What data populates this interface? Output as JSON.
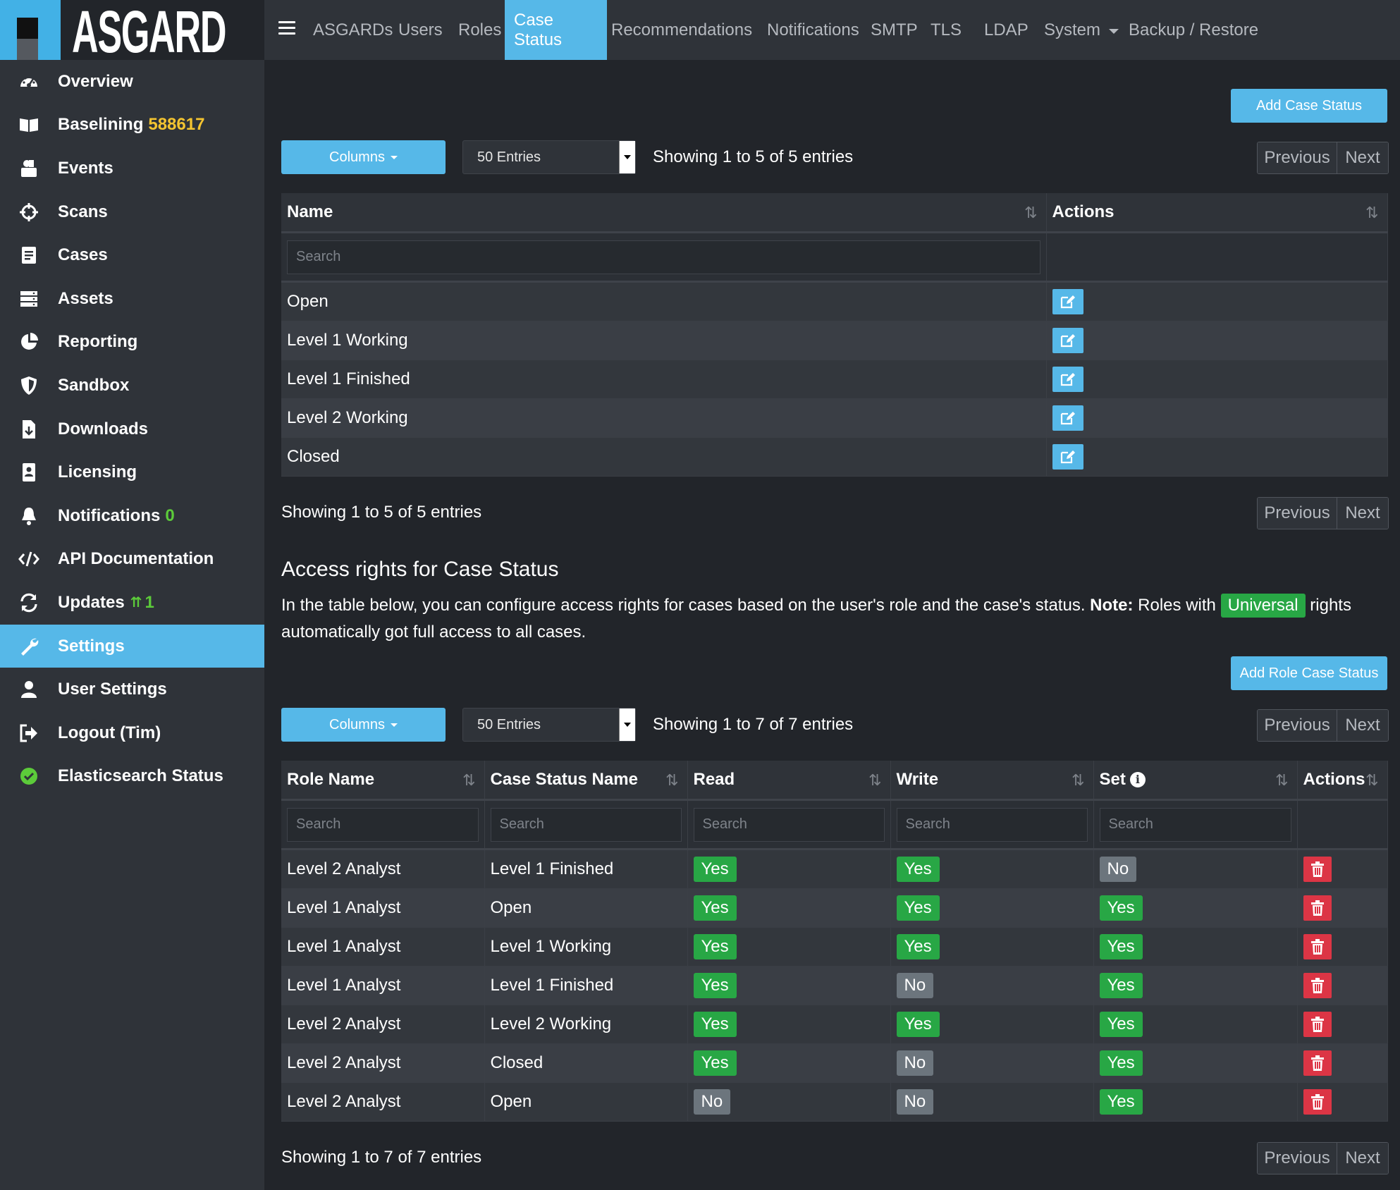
{
  "brand": {
    "name": "ASGARD"
  },
  "sidebar": {
    "items": [
      {
        "label": "Overview",
        "icon": "dashboard-icon"
      },
      {
        "label": "Baselining",
        "icon": "book-icon",
        "badge": "588617",
        "badge_color": "#f4c430"
      },
      {
        "label": "Events",
        "icon": "events-icon"
      },
      {
        "label": "Scans",
        "icon": "crosshair-icon"
      },
      {
        "label": "Cases",
        "icon": "cases-icon"
      },
      {
        "label": "Assets",
        "icon": "assets-icon"
      },
      {
        "label": "Reporting",
        "icon": "pie-chart-icon"
      },
      {
        "label": "Sandbox",
        "icon": "shield-icon"
      },
      {
        "label": "Downloads",
        "icon": "download-file-icon"
      },
      {
        "label": "Licensing",
        "icon": "license-icon"
      },
      {
        "label": "Notifications",
        "icon": "bell-icon",
        "badge": "0",
        "badge_color": "#5ccb3a"
      },
      {
        "label": "API Documentation",
        "icon": "code-icon"
      },
      {
        "label": "Updates",
        "icon": "sync-icon",
        "badge": "1",
        "badge_color": "#5ccb3a"
      },
      {
        "label": "Settings",
        "icon": "wrench-icon",
        "active": true
      },
      {
        "label": "User Settings",
        "icon": "user-icon"
      },
      {
        "label": "Logout (Tim)",
        "icon": "logout-icon"
      },
      {
        "label": "Elasticsearch Status",
        "icon": "check-circle-icon"
      }
    ]
  },
  "topnav": {
    "items": [
      "ASGARDs",
      "Users",
      "Roles",
      "Case Status",
      "Recommendations",
      "Notifications",
      "SMTP",
      "TLS",
      "LDAP",
      "System",
      "Backup / Restore"
    ],
    "active": "Case Status"
  },
  "case_status": {
    "add_button": "Add Case Status",
    "columns_button": "Columns",
    "entries": "50 Entries",
    "info_top": "Showing 1 to 5 of 5 entries",
    "info_bottom": "Showing 1 to 5 of 5 entries",
    "prev": "Previous",
    "next": "Next",
    "headers": [
      "Name",
      "Actions"
    ],
    "search_placeholder": "Search",
    "rows": [
      "Open",
      "Level 1 Working",
      "Level 1 Finished",
      "Level 2 Working",
      "Closed"
    ]
  },
  "access": {
    "title": "Access rights for Case Status",
    "desc_part1": "In the table below, you can configure access rights for cases based on the user's role and the case's status.",
    "desc_note": "Note:",
    "desc_part2": "Roles with",
    "desc_badge": "Universal",
    "desc_part3": "rights automatically got full access to all cases.",
    "add_button": "Add Role Case Status",
    "columns_button": "Columns",
    "entries": "50 Entries",
    "info_top": "Showing 1 to 7 of 7 entries",
    "info_bottom": "Showing 1 to 7 of 7 entries",
    "prev": "Previous",
    "next": "Next",
    "headers": [
      "Role Name",
      "Case Status Name",
      "Read",
      "Write",
      "Set",
      "Actions"
    ],
    "search_placeholder": "Search",
    "rows": [
      [
        "Level 2 Analyst",
        "Level 1 Finished",
        "Yes",
        "Yes",
        "No"
      ],
      [
        "Level 1 Analyst",
        "Open",
        "Yes",
        "Yes",
        "Yes"
      ],
      [
        "Level 1 Analyst",
        "Level 1 Working",
        "Yes",
        "Yes",
        "Yes"
      ],
      [
        "Level 1 Analyst",
        "Level 1 Finished",
        "Yes",
        "No",
        "Yes"
      ],
      [
        "Level 2 Analyst",
        "Level 2 Working",
        "Yes",
        "Yes",
        "Yes"
      ],
      [
        "Level 2 Analyst",
        "Closed",
        "Yes",
        "No",
        "Yes"
      ],
      [
        "Level 2 Analyst",
        "Open",
        "No",
        "No",
        "Yes"
      ]
    ]
  },
  "colors": {
    "accent": "#56b8e8",
    "yes": "#28a745",
    "no": "#6c757d",
    "danger": "#dc3545"
  }
}
